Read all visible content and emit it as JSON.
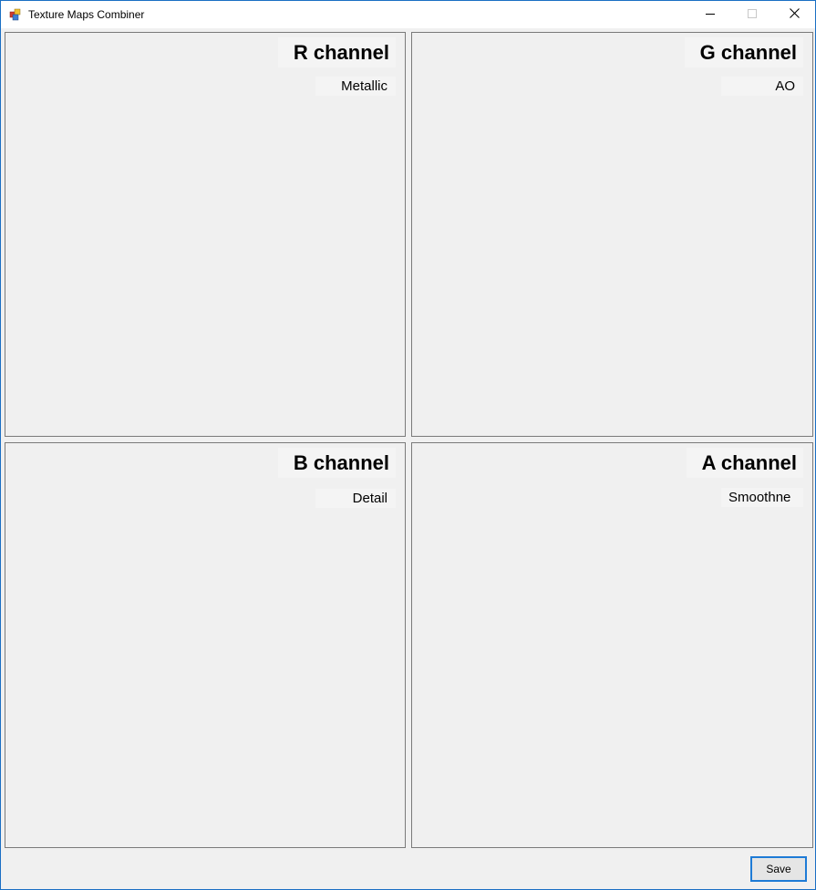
{
  "window": {
    "title": "Texture Maps Combiner",
    "app_icon": "app-icon",
    "controls": {
      "minimize_icon": "minimize-icon",
      "maximize_icon": "maximize-icon",
      "close_icon": "close-icon"
    }
  },
  "panels": [
    {
      "title": "R channel",
      "selected": "Metallic"
    },
    {
      "title": "G channel",
      "selected": "AO"
    },
    {
      "title": "B channel",
      "selected": "Detail"
    },
    {
      "title": "A channel",
      "selected": "Smoothne"
    }
  ],
  "footer": {
    "save_label": "Save"
  },
  "colors": {
    "window_border": "#1a6fc4",
    "background": "#f0f0f0",
    "panel_border": "#7a7a7a",
    "button_focus_border": "#1e7bd6"
  }
}
